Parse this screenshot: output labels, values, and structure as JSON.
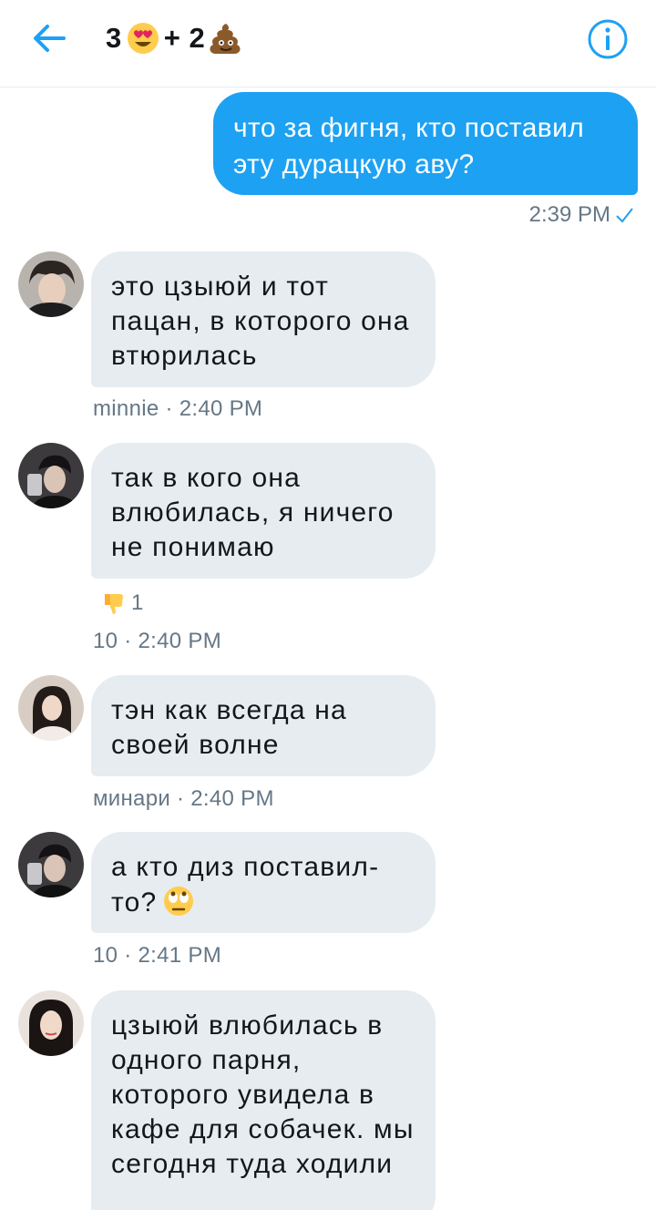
{
  "header": {
    "title_part1": "3",
    "title_emoji1": "heart-eyes-emoji",
    "title_part2": "+ 2",
    "title_emoji2": "poop-emoji",
    "accent_color": "#1da1f2"
  },
  "messages": [
    {
      "direction": "outgoing",
      "text": "что за фигня, кто поставил эту дурацкую аву?",
      "time": "2:39 PM",
      "status_icon": "check-icon"
    },
    {
      "direction": "incoming",
      "avatar": "avatar-minnie",
      "text": "это цзыюй и тот пацан, в которого она втюрилась",
      "meta": "minnie · 2:40 PM"
    },
    {
      "direction": "incoming",
      "avatar": "avatar-10",
      "text": "так в кого она влюбилась, я ничего не понимаю",
      "reaction_icon": "thumbs-down-emoji",
      "reaction_count": "1",
      "meta": "10 · 2:40 PM"
    },
    {
      "direction": "incoming",
      "avatar": "avatar-minari",
      "text": "тэн как всегда на своей волне",
      "meta": "минари · 2:40 PM"
    },
    {
      "direction": "incoming",
      "avatar": "avatar-10",
      "text": "а кто диз поставил-то?",
      "trailing_emoji": "eye-roll-emoji",
      "meta": "10 · 2:41 PM"
    },
    {
      "direction": "incoming",
      "avatar": "avatar-girl",
      "text": "цзыюй влюбилась в одного парня, которого увидела в кафе для собачек. мы сегодня туда ходили"
    }
  ]
}
